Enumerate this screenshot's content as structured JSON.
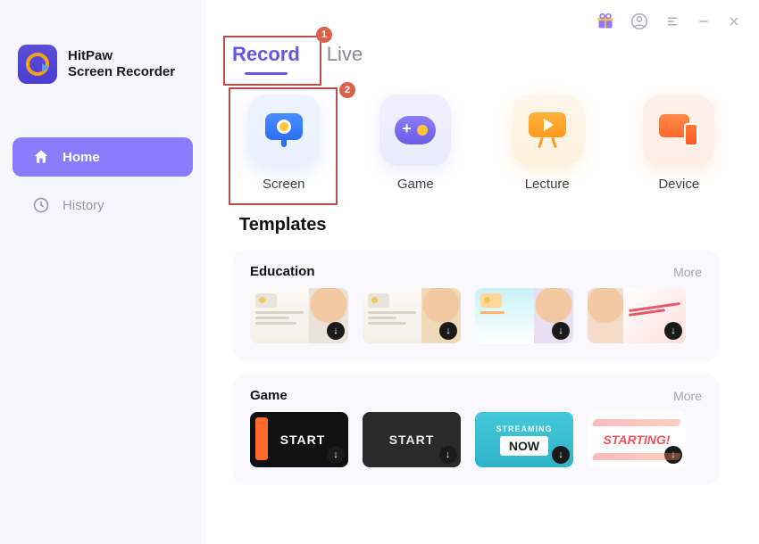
{
  "app": {
    "name": "HitPaw",
    "subtitle": "Screen Recorder"
  },
  "sidebar": {
    "items": [
      {
        "label": "Home"
      },
      {
        "label": "History"
      }
    ]
  },
  "titlebar": {
    "gift": "gift-icon",
    "account": "account-icon",
    "menu": "menu-icon",
    "minimize": "minimize",
    "close": "close"
  },
  "tabs": [
    {
      "label": "Record",
      "active": true
    },
    {
      "label": "Live",
      "active": false
    }
  ],
  "annotations": {
    "tab_badge": "1",
    "mode_badge": "2"
  },
  "modes": [
    {
      "label": "Screen"
    },
    {
      "label": "Game"
    },
    {
      "label": "Lecture"
    },
    {
      "label": "Device"
    }
  ],
  "sections": {
    "templates_title": "Templates"
  },
  "template_groups": [
    {
      "name": "Education",
      "more": "More",
      "items": [
        {
          "id": "edu-1"
        },
        {
          "id": "edu-2"
        },
        {
          "id": "edu-3"
        },
        {
          "id": "edu-4"
        }
      ]
    },
    {
      "name": "Game",
      "more": "More",
      "items": [
        {
          "label": "START"
        },
        {
          "label": "START"
        },
        {
          "top": "STREAMING",
          "big": "NOW"
        },
        {
          "label": "STARTING!"
        }
      ]
    }
  ],
  "colors": {
    "accent": "#8C7BFA",
    "tab_active": "#6556E6",
    "annot": "#C04B4B"
  }
}
